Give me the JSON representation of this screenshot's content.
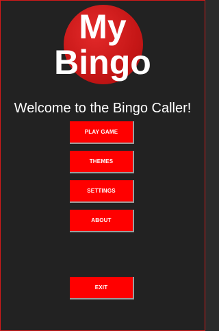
{
  "logo": {
    "line1": "My",
    "line2": "Bingo"
  },
  "welcome_text": "Welcome to the Bingo Caller!",
  "menu": {
    "play_game": "PLAY GAME",
    "themes": "THEMES",
    "settings": "SETTINGS",
    "about": "ABOUT",
    "exit": "EXIT"
  },
  "colors": {
    "background": "#222222",
    "accent": "#ff0000",
    "border": "#d21a1a",
    "text": "#ffffff"
  }
}
